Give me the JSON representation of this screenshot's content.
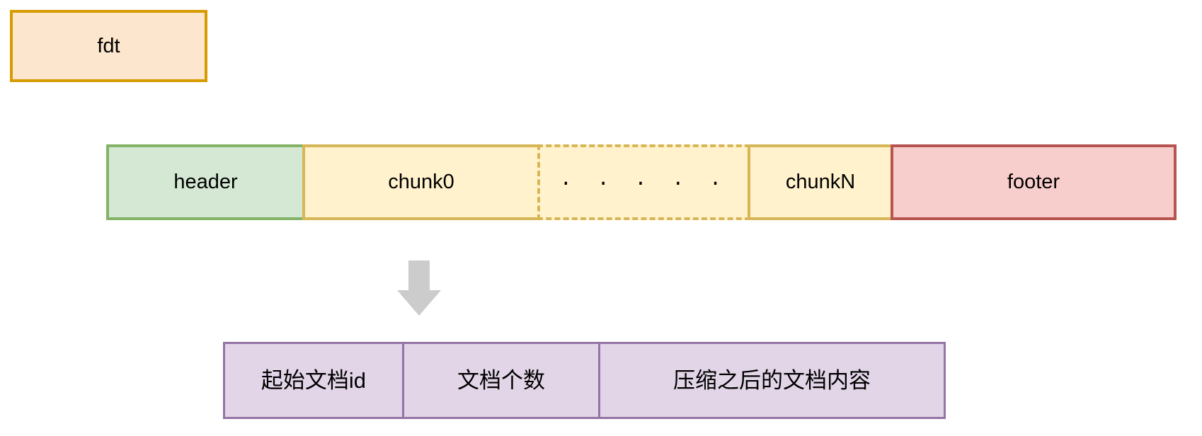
{
  "diagram": {
    "title_box": {
      "label": "fdt",
      "fill": "#fce6cd",
      "stroke": "#d79b00"
    },
    "file_layout": {
      "segments": [
        {
          "label": "header",
          "fill": "#d5e8d4",
          "stroke": "#82b366",
          "style": "solid"
        },
        {
          "label": "chunk0",
          "fill": "#fff2cc",
          "stroke": "#d6b656",
          "style": "solid"
        },
        {
          "label": ". . . . .",
          "fill": "#fff2cc",
          "stroke": "#d6b656",
          "style": "dashed"
        },
        {
          "label": "chunkN",
          "fill": "#fff2cc",
          "stroke": "#d6b656",
          "style": "solid"
        },
        {
          "label": "footer",
          "fill": "#f8cecc",
          "stroke": "#b85450",
          "style": "solid"
        }
      ]
    },
    "connector": {
      "icon": "down-arrow-icon",
      "direction": "down",
      "color": "#cccccc"
    },
    "chunk_detail": {
      "fill": "#e1d5e7",
      "stroke": "#9673a6",
      "fields": [
        {
          "label": "起始文档id"
        },
        {
          "label": "文档个数"
        },
        {
          "label": "压缩之后的文档内容"
        }
      ]
    }
  }
}
